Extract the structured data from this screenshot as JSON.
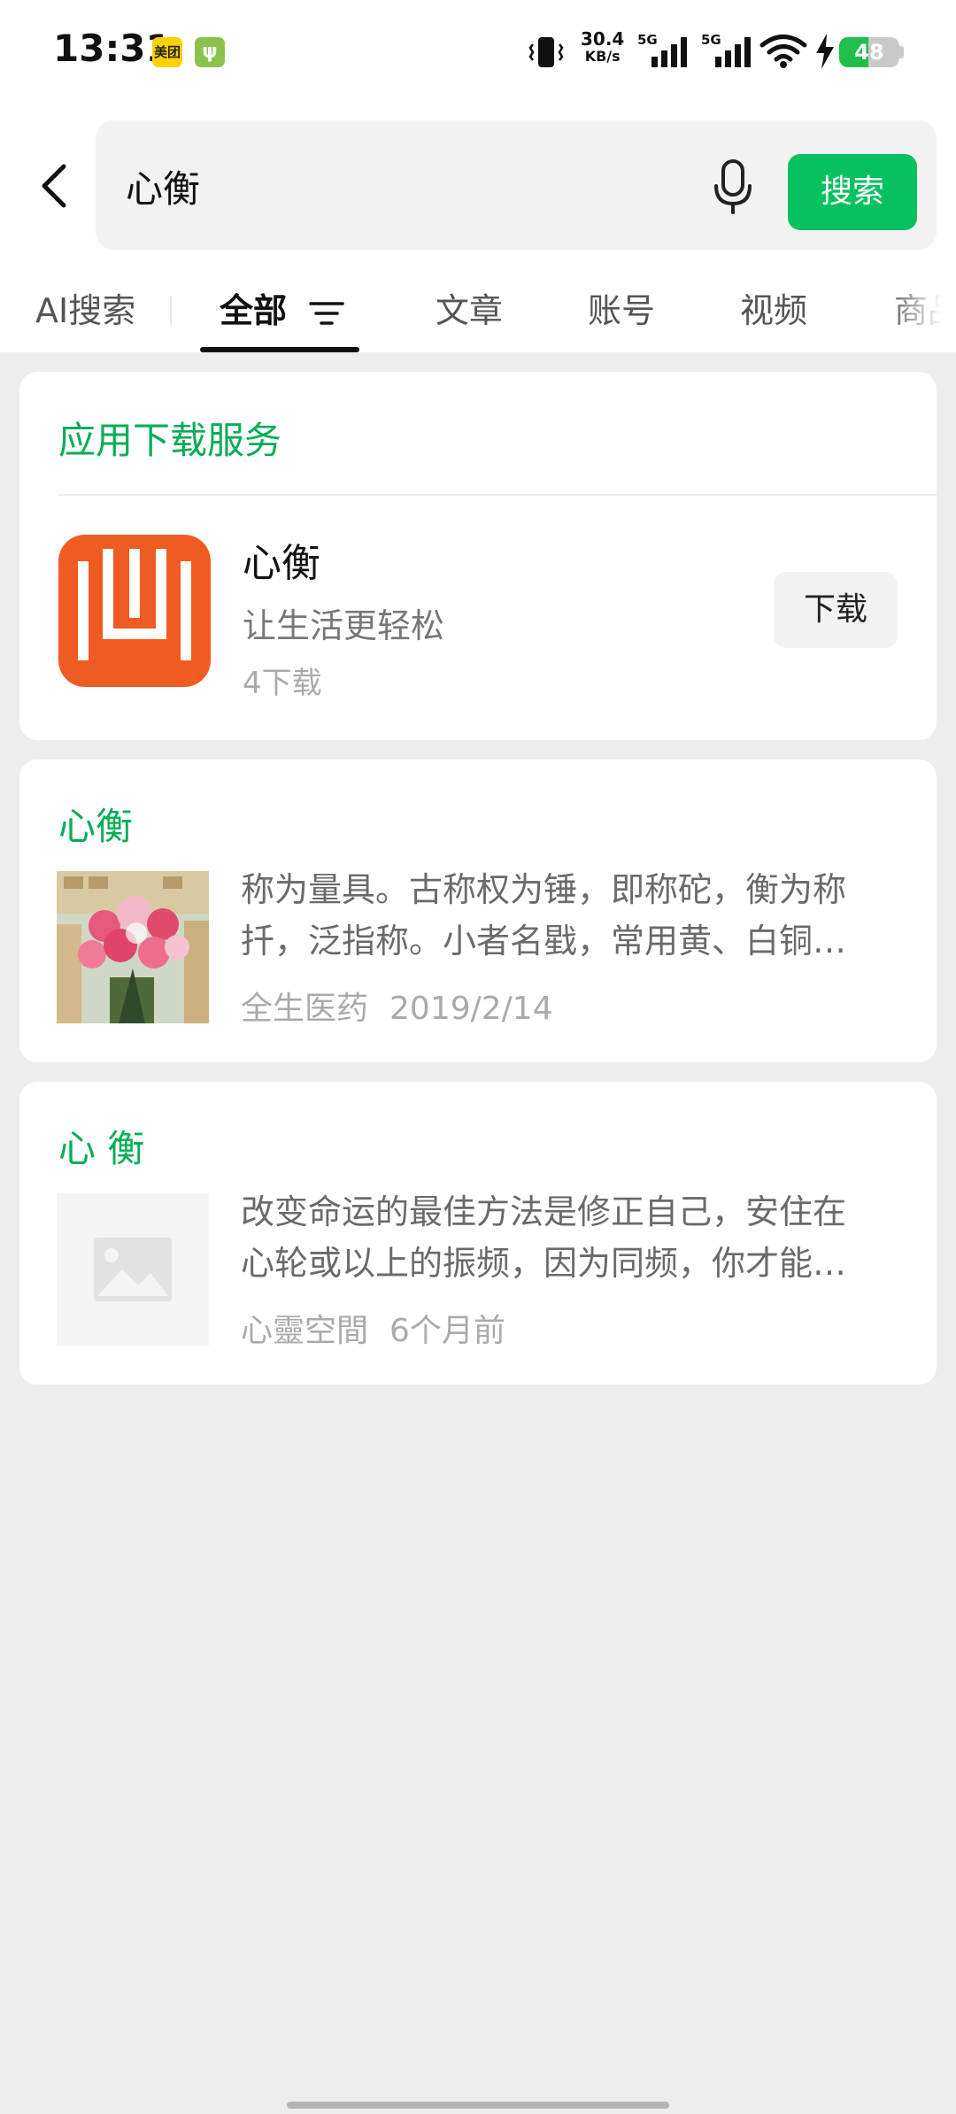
{
  "status_bar": {
    "time": "13:31",
    "app_badges": [
      "美团",
      "ψ"
    ],
    "net_speed_value": "30.4",
    "net_speed_unit": "KB/s",
    "signal_1_label": "5G",
    "signal_2_label": "5G",
    "battery_level": "48",
    "battery_fraction": 0.48
  },
  "search": {
    "query": "心衡",
    "search_button": "搜索"
  },
  "tabs": {
    "ai": "AI搜索",
    "all": "全部",
    "article": "文章",
    "account": "账号",
    "video": "视频",
    "product": "商品"
  },
  "app_card": {
    "section_title": "应用下载服务",
    "app_name": "心衡",
    "app_desc": "让生活更轻松",
    "download_count": "4下载",
    "download_button": "下载"
  },
  "results": [
    {
      "title": "心衡",
      "line1": "称为量具。古称权为锤，即称砣，衡为称",
      "line2": "扦，泛指称。小者名戥，常用黄、白铜…",
      "source": "全生医药",
      "date": "2019/2/14"
    },
    {
      "title": "心 衡",
      "line1": "改变命运的最佳方法是修正自己，安住在",
      "line2": "心轮或以上的振频，因为同频，你才能…",
      "source": "心靈空間",
      "date": "6个月前"
    }
  ],
  "colors": {
    "accent_green": "#07c160",
    "title_green": "#06ad56",
    "app_icon_orange": "#f05a23",
    "background": "#ededed"
  }
}
